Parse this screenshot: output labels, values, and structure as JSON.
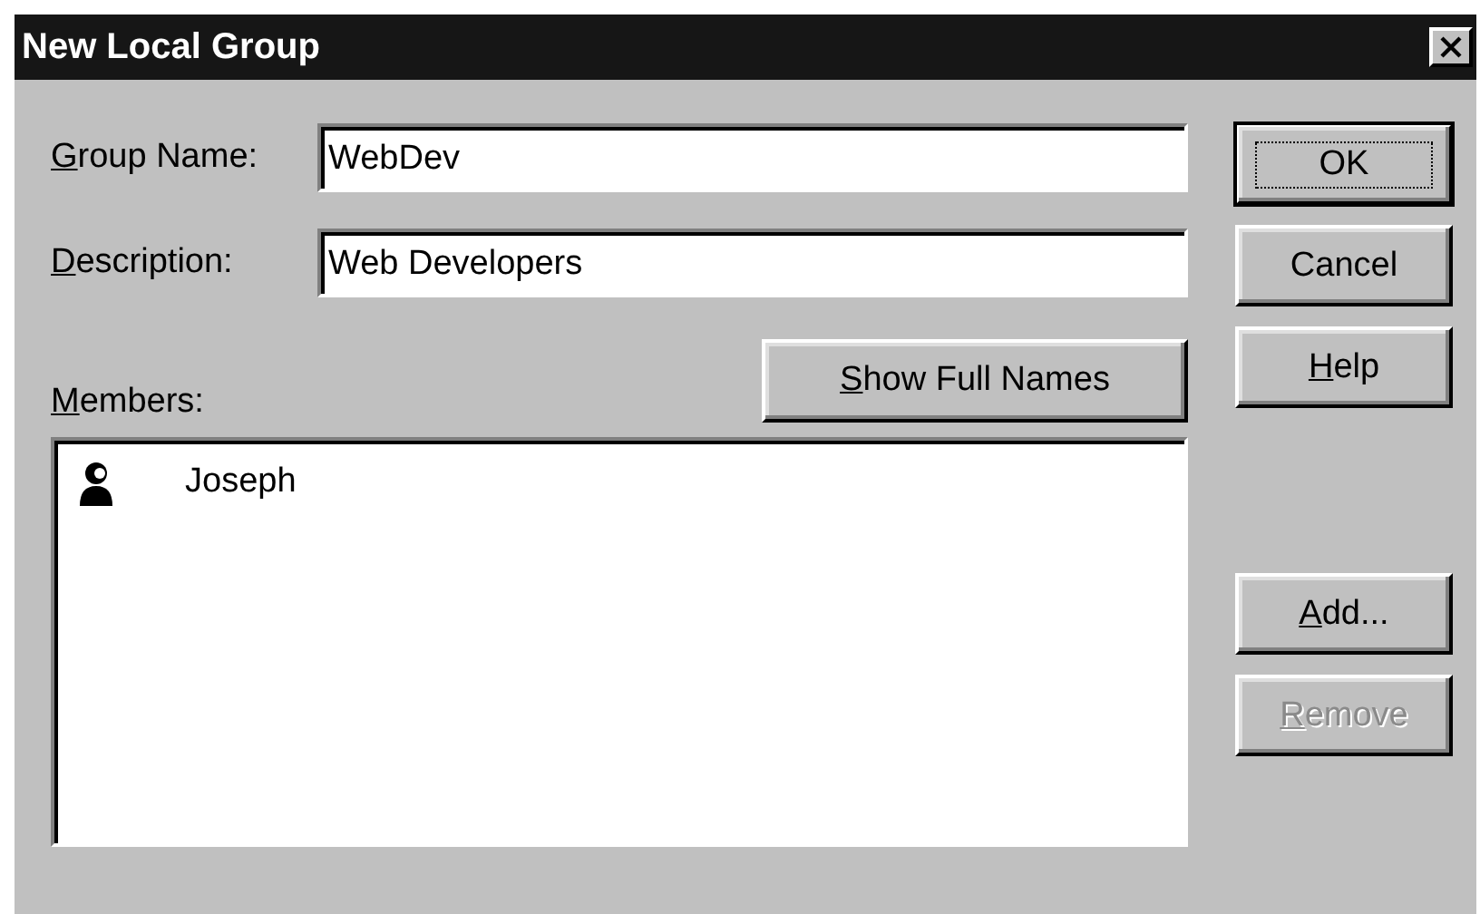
{
  "window": {
    "title": "New Local Group"
  },
  "fields": [
    {
      "label": "Group Name:",
      "access_key": true,
      "value": "WebDev"
    },
    {
      "label": "Description:",
      "access_key": true,
      "value": "Web Developers"
    }
  ],
  "show_full_names": {
    "label": "Show Full Names",
    "access_key": true,
    "disabled": false
  },
  "members": {
    "label": "Members:",
    "access_key": true,
    "items": [
      {
        "name": "Joseph",
        "selected": false
      }
    ]
  },
  "buttons": [
    {
      "label": "OK",
      "access_key": false,
      "default": true,
      "disabled": false
    },
    {
      "label": "Cancel",
      "access_key": false,
      "default": false,
      "disabled": false
    },
    {
      "label": "Help",
      "access_key": true,
      "default": false,
      "disabled": false
    }
  ],
  "member_buttons": [
    {
      "label": "Add...",
      "access_key": true,
      "disabled": false
    },
    {
      "label": "Remove",
      "access_key": true,
      "disabled": true
    }
  ]
}
